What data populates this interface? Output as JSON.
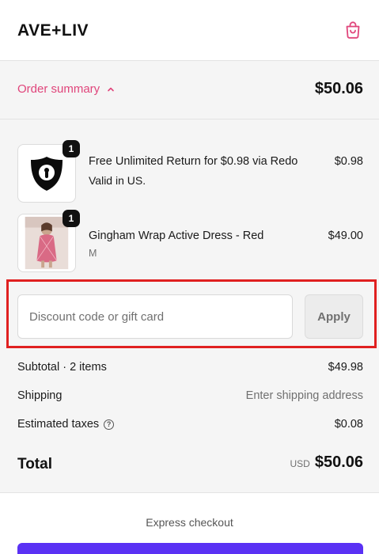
{
  "header": {
    "brand": "AVE+LIV",
    "cart_icon": "shopping-bag-icon"
  },
  "summary": {
    "toggle_label": "Order summary",
    "toggle_icon": "chevron-up-icon",
    "total": "$50.06"
  },
  "items": [
    {
      "quantity": "1",
      "title": "Free Unlimited Return for $0.98 via Redo",
      "subtitle": "Valid in US.",
      "price": "$0.98",
      "image": "redo-shield-logo"
    },
    {
      "quantity": "1",
      "title": "Gingham Wrap Active Dress - Red",
      "subtitle": "M",
      "price": "$49.00",
      "image": "product-photo-dress"
    }
  ],
  "discount": {
    "placeholder": "Discount code or gift card",
    "value": "",
    "apply_label": "Apply"
  },
  "totals": {
    "subtotal_label": "Subtotal · 2 items",
    "subtotal_value": "$49.98",
    "shipping_label": "Shipping",
    "shipping_value": "Enter shipping address",
    "taxes_label": "Estimated taxes",
    "taxes_icon": "help-circle-icon",
    "taxes_value": "$0.08",
    "total_label": "Total",
    "total_currency": "USD",
    "total_value": "$50.06"
  },
  "express": {
    "label": "Express checkout"
  },
  "colors": {
    "accent_pink": "#e0457b",
    "highlight_red": "#e02020",
    "pay_purple": "#5a31f4"
  }
}
